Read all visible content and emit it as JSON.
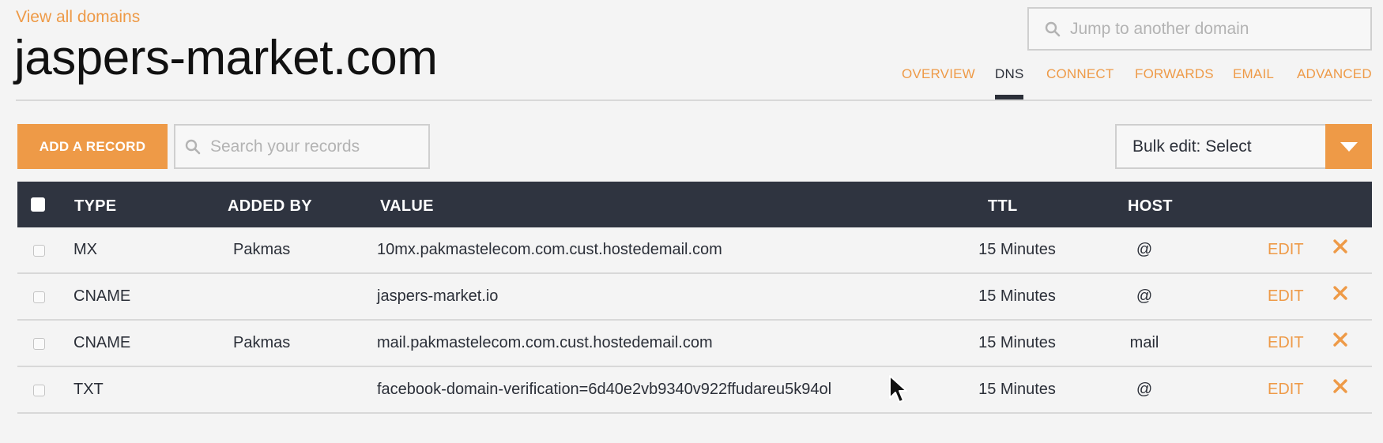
{
  "header": {
    "view_all_label": "View all domains",
    "domain_name": "jaspers-market.com",
    "jump_placeholder": "Jump to another domain"
  },
  "tabs": [
    {
      "label": "OVERVIEW",
      "active": false
    },
    {
      "label": "DNS",
      "active": true
    },
    {
      "label": "CONNECT",
      "active": false
    },
    {
      "label": "FORWARDS",
      "active": false
    },
    {
      "label": "EMAIL",
      "active": false
    },
    {
      "label": "ADVANCED",
      "active": false
    }
  ],
  "toolbar": {
    "add_record_label": "ADD A RECORD",
    "search_placeholder": "Search your records",
    "bulk_edit_label": "Bulk edit: Select"
  },
  "table": {
    "columns": {
      "type": "TYPE",
      "added_by": "ADDED BY",
      "value": "VALUE",
      "ttl": "TTL",
      "host": "HOST"
    },
    "rows": [
      {
        "type": "MX",
        "added_by": "Pakmas",
        "value": "10mx.pakmastelecom.com.cust.hostedemail.com",
        "ttl": "15 Minutes",
        "host": "@",
        "edit_label": "EDIT"
      },
      {
        "type": "CNAME",
        "added_by": "",
        "value": "jaspers-market.io",
        "ttl": "15 Minutes",
        "host": "@",
        "edit_label": "EDIT"
      },
      {
        "type": "CNAME",
        "added_by": "Pakmas",
        "value": "mail.pakmastelecom.com.cust.hostedemail.com",
        "ttl": "15 Minutes",
        "host": "mail",
        "edit_label": "EDIT"
      },
      {
        "type": "TXT",
        "added_by": "",
        "value": "facebook-domain-verification=6d40e2vb9340v922ffudareu5k94ol",
        "ttl": "15 Minutes",
        "host": "@",
        "edit_label": "EDIT"
      }
    ]
  },
  "colors": {
    "accent": "#ee9a47",
    "header_bar": "#2f3440",
    "background": "#f4f4f4"
  },
  "icons": {
    "search": "search-icon",
    "dropdown": "chevron-down-icon",
    "delete": "close-icon",
    "pointer": "mouse-cursor-icon"
  }
}
